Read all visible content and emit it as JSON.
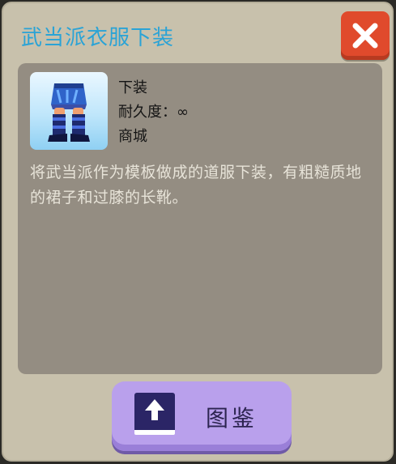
{
  "dialog": {
    "title": "武当派衣服下装",
    "close_icon": "close-x-icon",
    "colors": {
      "title": "#2aa3d6",
      "close_button": "#e04a2c",
      "panel": "#948d82",
      "catalog_button": "#b9a0ec"
    }
  },
  "item": {
    "icon": "armor-pants-boots-icon",
    "category": "下装",
    "durability": "耐久度：∞",
    "source": "商城",
    "description": "将武当派作为模板做成的道服下装，有粗糙质地的裙子和过膝的长靴。"
  },
  "catalog_button": {
    "icon": "book-upload-icon",
    "label": "图鉴"
  }
}
